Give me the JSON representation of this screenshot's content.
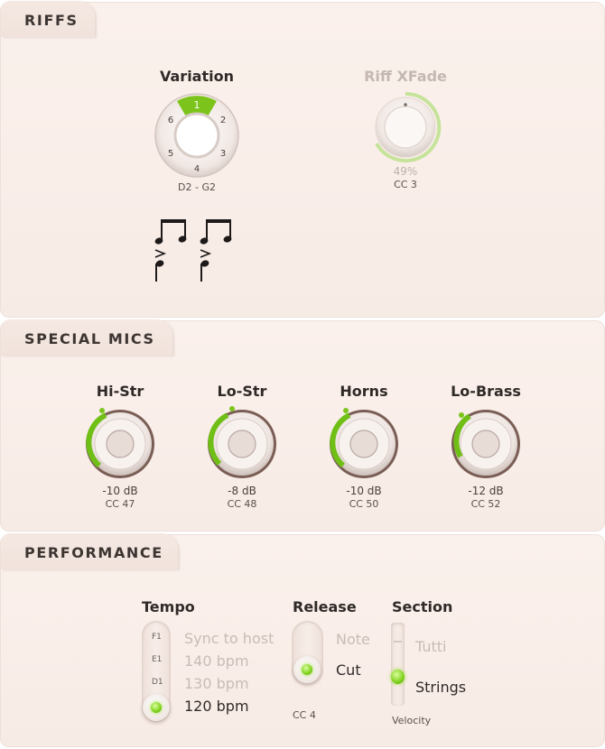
{
  "colors": {
    "accent": "#7cc41c",
    "panel": "#f8ede8",
    "muted": "#c8bcb6"
  },
  "riffs": {
    "tab_label": "RIFFS",
    "variation": {
      "title": "Variation",
      "segments": [
        "1",
        "2",
        "3",
        "4",
        "5",
        "6"
      ],
      "selected": "1",
      "range": "D2 - G2"
    },
    "xfade": {
      "title": "Riff XFade",
      "value": "49%",
      "value_fraction": 0.49,
      "cc": "CC 3"
    },
    "notation_icon": "rhythm-notation-icon"
  },
  "special_mics": {
    "tab_label": "SPECIAL MICS",
    "knobs": [
      {
        "title": "Hi-Str",
        "value": "-10 dB",
        "cc": "CC 47",
        "level": 0.28
      },
      {
        "title": "Lo-Str",
        "value": "-8 dB",
        "cc": "CC 48",
        "level": 0.32
      },
      {
        "title": "Horns",
        "value": "-10 dB",
        "cc": "CC 50",
        "level": 0.28
      },
      {
        "title": "Lo-Brass",
        "value": "-12 dB",
        "cc": "CC 52",
        "level": 0.24
      }
    ]
  },
  "performance": {
    "tab_label": "PERFORMANCE",
    "tempo": {
      "title": "Tempo",
      "steps": [
        "F1",
        "E1",
        "D1"
      ],
      "options": [
        "Sync to host",
        "140 bpm",
        "130 bpm",
        "120 bpm"
      ],
      "selected": "120 bpm"
    },
    "release": {
      "title": "Release",
      "options": [
        "Note",
        "Cut"
      ],
      "selected": "Cut",
      "cc": "CC 4"
    },
    "section": {
      "title": "Section",
      "options": [
        "Tutti",
        "Strings"
      ],
      "selected": "Strings",
      "footer": "Velocity"
    }
  }
}
